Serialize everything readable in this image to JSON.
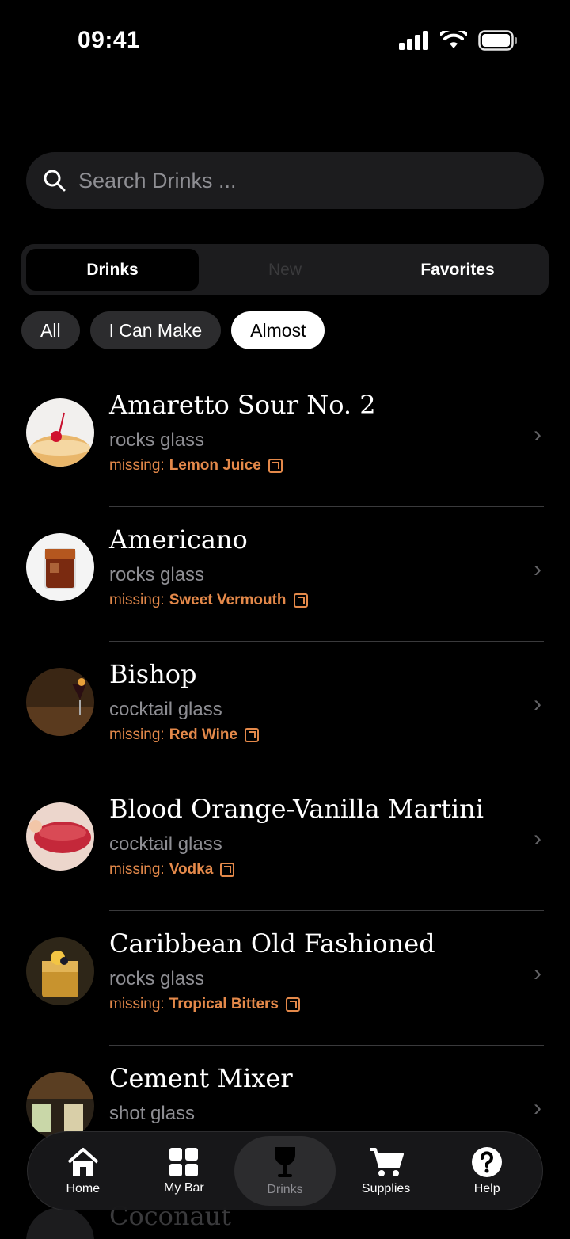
{
  "status": {
    "time": "09:41"
  },
  "search": {
    "placeholder": "Search Drinks ..."
  },
  "segments": [
    "Drinks",
    "New",
    "Favorites"
  ],
  "chips": [
    "All",
    "I Can Make",
    "Almost"
  ],
  "missing_label": "missing:",
  "drinks": [
    {
      "name": "Amaretto Sour No. 2",
      "glass": "rocks glass",
      "missing": "Lemon Juice"
    },
    {
      "name": "Americano",
      "glass": "rocks glass",
      "missing": "Sweet Vermouth"
    },
    {
      "name": "Bishop",
      "glass": "cocktail glass",
      "missing": "Red Wine"
    },
    {
      "name": "Blood Orange-Vanilla Martini",
      "glass": "cocktail glass",
      "missing": "Vodka"
    },
    {
      "name": "Caribbean Old Fashioned",
      "glass": "rocks glass",
      "missing": "Tropical Bitters"
    },
    {
      "name": "Cement Mixer",
      "glass": "shot glass",
      "missing": ""
    }
  ],
  "peek_name": "Coconaut",
  "tabs": [
    {
      "label": "Home",
      "icon": "home-icon"
    },
    {
      "label": "My Bar",
      "icon": "grid-icon"
    },
    {
      "label": "Drinks",
      "icon": "wine-glass-icon"
    },
    {
      "label": "Supplies",
      "icon": "cart-icon"
    },
    {
      "label": "Help",
      "icon": "help-icon"
    }
  ],
  "colors": {
    "accent": "#e4894a",
    "background": "#000000"
  }
}
